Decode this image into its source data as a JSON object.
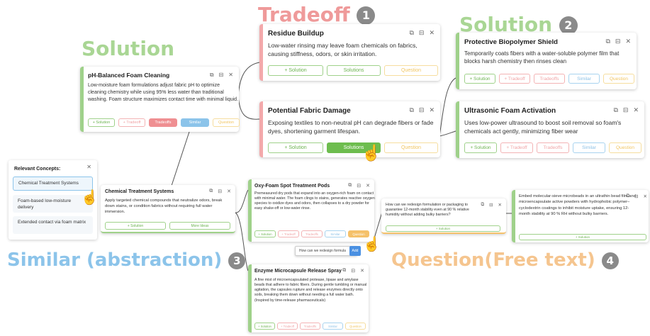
{
  "headings": {
    "tradeoff": {
      "label": "Tradeoff",
      "num": "1"
    },
    "solution_right": {
      "label": "Solution",
      "num": "2"
    },
    "solution_left": {
      "label": "Solution"
    },
    "similar": {
      "label": "Similar (abstraction)",
      "num": "3"
    },
    "question": {
      "label": "Question(Free text)",
      "num": "4"
    }
  },
  "colors": {
    "solution": "#9fd18a",
    "tradeoff": "#f3a9ab",
    "similar": "#8cc4ea",
    "question": "#f5c16a",
    "heading_num": "#8a8a8a"
  },
  "icons": {
    "copy": "copy-icon",
    "bookmark": "bookmark-icon",
    "close": "close-icon",
    "cursor": "hand-pointer-icon"
  },
  "card_ph": {
    "title": "pH-Balanced Foam Cleaning",
    "body": "Low-moisture foam formulations adjust fabric pH to optimize cleaning chemistry while using 95% less water than traditional washing. Foam structure maximizes contact time with minimal liquid.",
    "buttons": [
      "+ Solution",
      "+ Tradeoff",
      "Tradeoffs",
      "Similar",
      "Question"
    ]
  },
  "card_residue": {
    "title": "Residue Buildup",
    "body": "Low-water rinsing may leave foam chemicals on fabrics, causing stiffness, odors, or skin irritation.",
    "buttons": [
      "+ Solution",
      "Solutions",
      "Question"
    ]
  },
  "card_damage": {
    "title": "Potential Fabric Damage",
    "body": "Exposing textiles to non-neutral pH can degrade fibers or fade dyes, shortening garment lifespan.",
    "buttons": [
      "+ Solution",
      "Solutions",
      "Question"
    ]
  },
  "card_biopolymer": {
    "title": "Protective Biopolymer Shield",
    "body": "Temporarily coats fibers with a water-soluble polymer film that blocks harsh chemistry then rinses clean",
    "buttons": [
      "+ Solution",
      "+ Tradeoff",
      "Tradeoffs",
      "Similar",
      "Question"
    ]
  },
  "card_ultrasonic": {
    "title": "Ultrasonic Foam Activation",
    "body": "Uses low-power ultrasound to boost soil removal so foam's chemicals act gently, minimizing fiber wear",
    "buttons": [
      "+ Solution",
      "+ Tradeoff",
      "Tradeoffs",
      "Similar",
      "Question"
    ]
  },
  "concepts": {
    "header": "Relevant Concepts:",
    "items": [
      "Chemical Treatment Systems",
      "Foam-based low-moisture delivery",
      "Extended contact via foam matrix"
    ]
  },
  "card_chem": {
    "title": "Chemical Treatment Systems",
    "body": "Apply targeted chemical compounds that neutralize odors, break down stains, or condition fabrics without requiring full water immersion.",
    "buttons": [
      "+ Solution",
      "More Ideas"
    ]
  },
  "card_oxy": {
    "title": "Oxy-Foam Spot Treatment Pods",
    "body": "Premeasured dry pods that expand into an oxygen-rich foam on contact with minimal water. The foam clings to stains, generates reactive oxygen species to oxidize dyes and odors, then collapses to a dry powder for easy shake-off or low-water rinse.",
    "buttons": [
      "+ Solution",
      "+ Tradeoff",
      "Tradeoffs",
      "Similar",
      "Question"
    ],
    "input_value": "How can we redesign formula",
    "input_button": "Add"
  },
  "card_enzyme": {
    "title": "Enzyme Microcapsule Release Spray",
    "body": "A fine mist of microencapsulated protease, lipase and amylase beads that adhere to fabric fibers. During gentle tumbling or manual agitation, the capsules rupture and release enzymes directly onto soils, breaking them down without needing a full water bath. (Inspired by time-release pharmaceuticals)",
    "buttons": [
      "+ Solution",
      "+ Tradeoff",
      "Tradeoffs",
      "Similar",
      "Question"
    ]
  },
  "card_question": {
    "body": "How can we redesign formulation or packaging to guarantee 12-month stability even at 90 % relative humidity without adding bulky barriers?",
    "buttons": [
      "+ Solution"
    ]
  },
  "card_answer": {
    "body": "Embed molecular-sieve microbeads in an ultrathin bead film and microencapsulate active powders with hydrophobic polymer–cyclodextrin coatings to inhibit moisture uptake, ensuring 12-month stability at 90 % RH without bulky barriers.",
    "buttons": [
      "+ Solution"
    ]
  }
}
